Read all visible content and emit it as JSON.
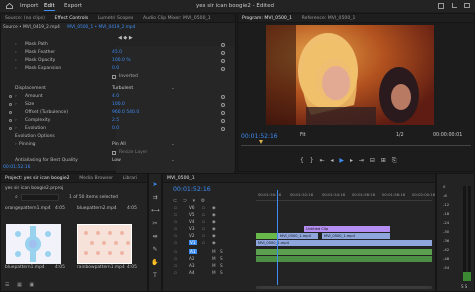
{
  "window_title": "yes sir ican boogie2 - Edited",
  "menu": {
    "home": "Import",
    "edit": "Edit",
    "export": "Export"
  },
  "source_panel": {
    "tabs": [
      "Source: (no clips)",
      "Effect Controls",
      "Lumetri Scopes",
      "Audio Clip Mixer: MVI_0500_1"
    ],
    "clip_path": "Source • MVI_0419_2.mp4",
    "clip_target": "MVI_0500_1 • MVI_0419_2.mp4",
    "properties": [
      {
        "label": "Mask Path",
        "value": ""
      },
      {
        "label": "Mask Feather",
        "value": "45.0"
      },
      {
        "label": "Mask Opacity",
        "value": "100.0 %"
      },
      {
        "label": "Mask Expansion",
        "value": "0.0"
      },
      {
        "label": "",
        "value": "Inverted"
      },
      {
        "label": "Displacement",
        "value": "Turbulent"
      },
      {
        "label": "Amount",
        "value": "4.0"
      },
      {
        "label": "Size",
        "value": "100.0"
      },
      {
        "label": "Offset (Turbulence)",
        "value": "960.0    540.0"
      },
      {
        "label": "Complexity",
        "value": "2.5"
      },
      {
        "label": "Evolution",
        "value": "0.0"
      },
      {
        "label": "Evolution Options",
        "value": ""
      },
      {
        "label": "Pinning",
        "value": "Pin All"
      },
      {
        "label": "",
        "value": "Resize Layer"
      },
      {
        "label": "Antialiasing for Best Quality",
        "value": "Low"
      }
    ],
    "timecode": "00:01:52:16"
  },
  "program_panel": {
    "tabs": [
      "Program: MVI_0500_1",
      "Reference: MVI_0500_1"
    ],
    "timecode": "00:01:52:16",
    "fit": "Fit",
    "quality": "1/2",
    "duration": "00:00:00:01"
  },
  "project_panel": {
    "tabs": [
      "Project: yes sir ican boogie2",
      "Media Browser",
      "Librari"
    ],
    "filename": "yes sir ican boogie2.prproj",
    "selection": "1 of 50 items selected",
    "items": [
      {
        "name": "orangepattern1.mp4",
        "duration": "4:05"
      },
      {
        "name": "bluepattern2.mp4",
        "duration": "4:05"
      },
      {
        "name": "bluepattern1.mp4",
        "duration": "4:05"
      },
      {
        "name": "rainbowpattern1.mp4",
        "duration": "4:05"
      }
    ]
  },
  "timeline": {
    "tab": "MVI_0500_1",
    "timecode": "00:01:52:16",
    "ruler": [
      "00:01:50:16",
      "00:01:52:16",
      "00:01:54:16",
      "00:01:56:16",
      "00:01:58:16",
      "00:02:00:16"
    ],
    "tracks": [
      "V6",
      "V5",
      "V4",
      "V3",
      "V2",
      "V1",
      "A1",
      "A2",
      "A3",
      "A4"
    ],
    "clips": {
      "c1": "Untitled Clip",
      "c2": "MVI_0500_1.mp4",
      "c3": "MVI_0500_1.mp4",
      "c4": "MVI_0500_1.mp4"
    }
  },
  "audio_meter": {
    "labels": [
      "0",
      "-6",
      "-12",
      "-18",
      "-24",
      "-30",
      "-36",
      "-42",
      "-48",
      "-54"
    ],
    "footer": "S  S"
  },
  "colors": {
    "accent": "#3d8df5",
    "clip_green": "#69b84a",
    "clip_blue": "#8ea6dc",
    "clip_purple": "#b48ef2"
  }
}
